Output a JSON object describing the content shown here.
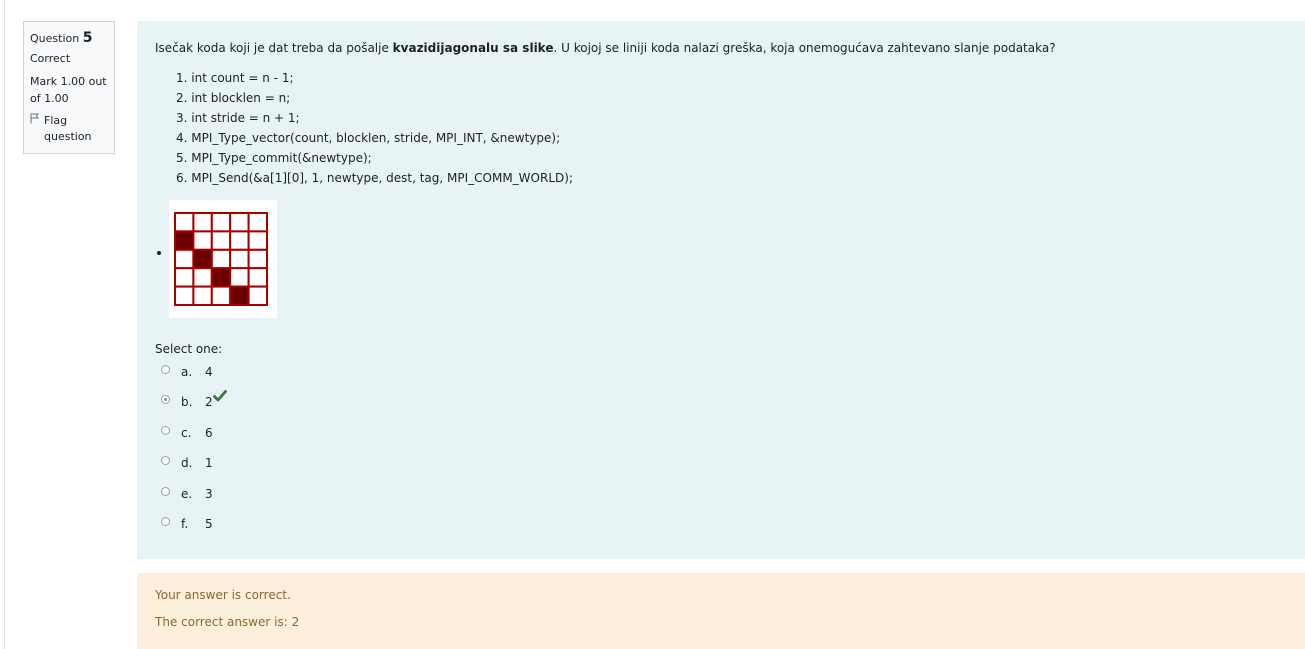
{
  "info": {
    "question_label": "Question",
    "question_number": "5",
    "state": "Correct",
    "grade_line1": "Mark 1.00 out",
    "grade_line2": "of 1.00",
    "flag_label_line1": "Flag",
    "flag_label_line2": "question",
    "flag_icon": "flag-outline-icon"
  },
  "question": {
    "text_before": "Isečak koda koji je dat treba da pošalje ",
    "text_bold": "kvazidijagonalu sa slike",
    "text_after": ". U kojoj se liniji koda nalazi greška, koja onemogućava zahtevano slanje podataka?",
    "code_lines": [
      "1. int count = n - 1;",
      "2. int blocklen = n;",
      "3. int stride = n + 1;",
      "4. MPI_Type_vector(count, blocklen, stride, MPI_INT, &newtype);",
      "5. MPI_Type_commit(&newtype);",
      "6. MPI_Send(&a[1][0], 1, newtype, dest, tag, MPI_COMM_WORLD);"
    ],
    "figure": {
      "rows": 5,
      "cols": 5,
      "filled_cells": [
        [
          1,
          0
        ],
        [
          2,
          1
        ],
        [
          3,
          2
        ],
        [
          4,
          3
        ]
      ],
      "grid_color": "#a50000",
      "fill_color": "#6b0000"
    }
  },
  "answer_block": {
    "prompt": "Select one:",
    "options": [
      {
        "letter": "a.",
        "value": "4",
        "checked": false
      },
      {
        "letter": "b.",
        "value": "2",
        "checked": true
      },
      {
        "letter": "c.",
        "value": "6",
        "checked": false
      },
      {
        "letter": "d.",
        "value": "1",
        "checked": false
      },
      {
        "letter": "e.",
        "value": "3",
        "checked": false
      },
      {
        "letter": "f.",
        "value": "5",
        "checked": false
      }
    ],
    "correct_icon": "check-icon",
    "correct_color": "#357a32"
  },
  "feedback": {
    "status": "Your answer is correct.",
    "correct_answer": "The correct answer is: 2"
  },
  "colors": {
    "content_bg": "#e7f3f5",
    "feedback_bg": "#fcefdc",
    "feedback_text": "#8e662e"
  }
}
